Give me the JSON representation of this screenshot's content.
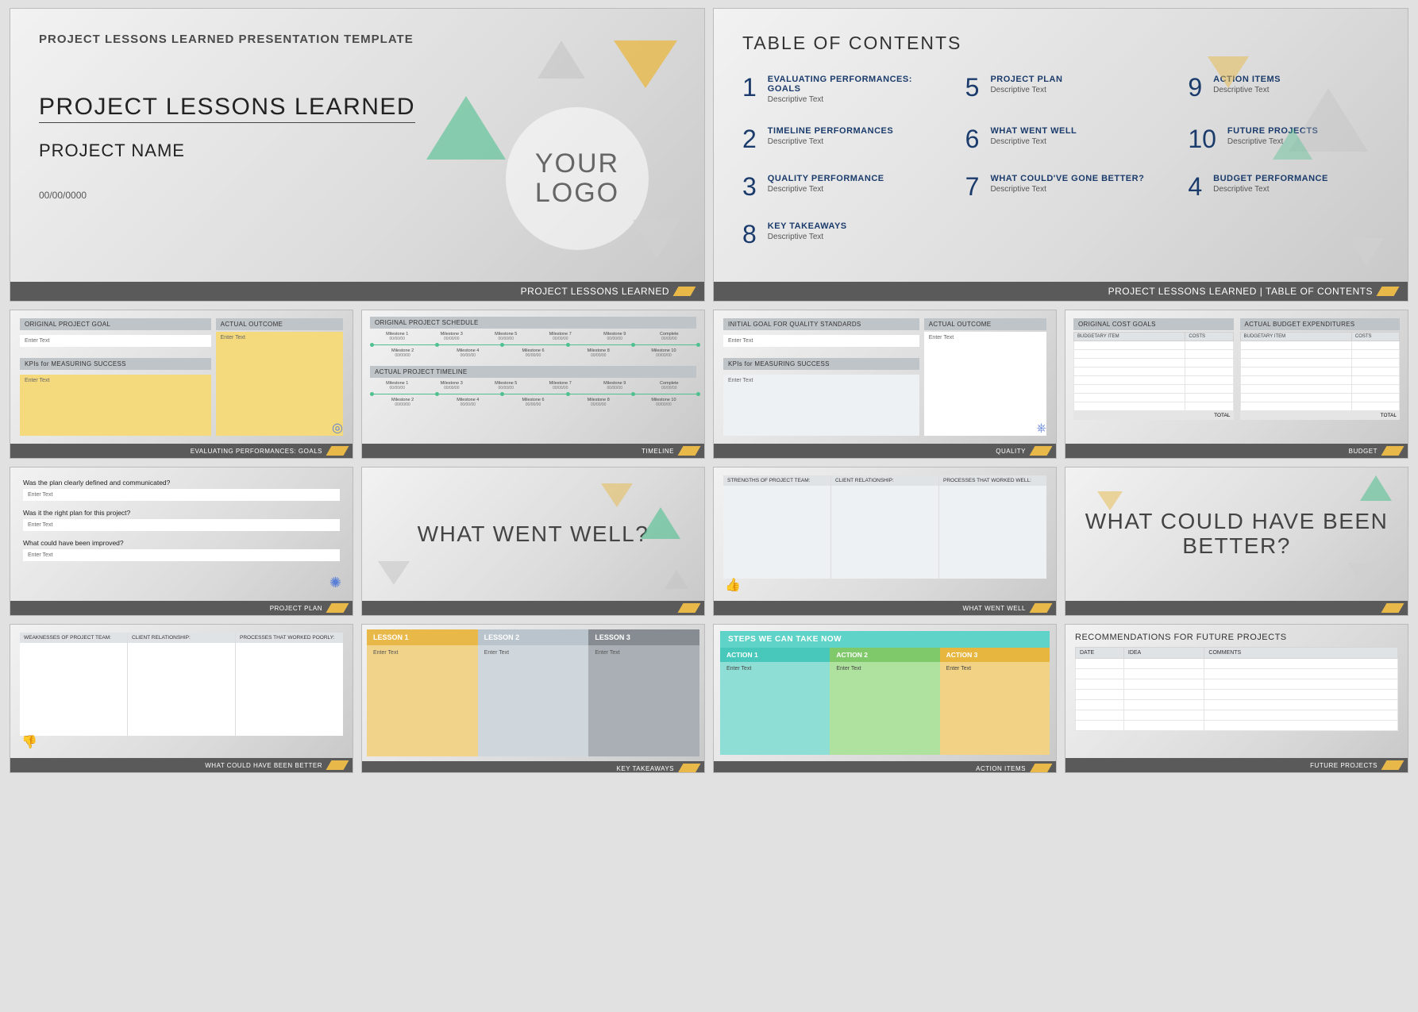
{
  "slide1": {
    "eyebrow": "PROJECT LESSONS LEARNED PRESENTATION TEMPLATE",
    "title": "PROJECT LESSONS LEARNED",
    "sub": "PROJECT NAME",
    "date": "00/00/0000",
    "logo": "YOUR LOGO",
    "footer": "PROJECT LESSONS LEARNED"
  },
  "slide2": {
    "title": "TABLE OF CONTENTS",
    "items": [
      {
        "n": "1",
        "t": "EVALUATING PERFORMANCES: GOALS",
        "d": "Descriptive Text"
      },
      {
        "n": "5",
        "t": "PROJECT PLAN",
        "d": "Descriptive Text"
      },
      {
        "n": "9",
        "t": "ACTION ITEMS",
        "d": "Descriptive Text"
      },
      {
        "n": "2",
        "t": "TIMELINE PERFORMANCES",
        "d": "Descriptive Text"
      },
      {
        "n": "6",
        "t": "WHAT WENT WELL",
        "d": "Descriptive Text"
      },
      {
        "n": "10",
        "t": "FUTURE PROJECTS",
        "d": "Descriptive Text"
      },
      {
        "n": "3",
        "t": "QUALITY PERFORMANCE",
        "d": "Descriptive Text"
      },
      {
        "n": "7",
        "t": "WHAT COULD'VE GONE BETTER?",
        "d": "Descriptive Text"
      },
      {
        "n": "4",
        "t": "BUDGET PERFORMANCE",
        "d": "Descriptive Text"
      },
      {
        "n": "8",
        "t": "KEY TAKEAWAYS",
        "d": "Descriptive Text"
      }
    ],
    "footer": "PROJECT LESSONS LEARNED   |   TABLE OF CONTENTS"
  },
  "slide3": {
    "goal_hdr": "ORIGINAL PROJECT GOAL",
    "outcome_hdr": "ACTUAL OUTCOME",
    "kpi_hdr": "KPIs for MEASURING SUCCESS",
    "enter": "Enter Text",
    "footer": "EVALUATING PERFORMANCES: GOALS"
  },
  "slide4": {
    "sched_hdr": "ORIGINAL PROJECT SCHEDULE",
    "actual_hdr": "ACTUAL PROJECT TIMELINE",
    "ms_top": [
      "Milestone 1",
      "Milestone 3",
      "Milestone 5",
      "Milestone 7",
      "Milestone 9",
      "Complete"
    ],
    "ms_bot": [
      "Milestone 2",
      "Milestone 4",
      "Milestone 6",
      "Milestone 8",
      "Milestone 10"
    ],
    "dt": "00/00/00",
    "footer": "TIMELINE"
  },
  "slide5": {
    "goal_hdr": "INITIAL GOAL FOR QUALITY STANDARDS",
    "outcome_hdr": "ACTUAL OUTCOME",
    "kpi_hdr": "KPIs for MEASURING SUCCESS",
    "enter": "Enter Text",
    "footer": "QUALITY"
  },
  "slide6": {
    "left_hdr": "ORIGINAL COST GOALS",
    "right_hdr": "ACTUAL BUDGET EXPENDITURES",
    "col1": "BUDGETARY ITEM",
    "col2": "COSTS",
    "total": "TOTAL",
    "footer": "BUDGET"
  },
  "slide7": {
    "q1": "Was the plan clearly defined and communicated?",
    "q2": "Was it the right plan for this project?",
    "q3": "What could have been improved?",
    "enter": "Enter Text",
    "footer": "PROJECT PLAN"
  },
  "slide8": {
    "q": "WHAT WENT WELL?",
    "footer": ""
  },
  "slide9": {
    "c1": "STRENGTHS OF PROJECT TEAM:",
    "c2": "CLIENT RELATIONSHIP:",
    "c3": "PROCESSES THAT WORKED WELL:",
    "footer": "WHAT WENT WELL"
  },
  "slide10": {
    "q": "WHAT COULD HAVE BEEN BETTER?",
    "footer": ""
  },
  "slide11": {
    "c1": "WEAKNESSES OF PROJECT TEAM:",
    "c2": "CLIENT RELATIONSHIP:",
    "c3": "PROCESSES THAT WORKED POORLY:",
    "footer": "WHAT COULD HAVE BEEN BETTER"
  },
  "slide12": {
    "l1": "LESSON 1",
    "l2": "LESSON 2",
    "l3": "LESSON 3",
    "enter": "Enter Text",
    "footer": "KEY TAKEAWAYS"
  },
  "slide13": {
    "banner": "STEPS WE CAN TAKE NOW",
    "a1": "ACTION 1",
    "a2": "ACTION 2",
    "a3": "ACTION 3",
    "enter": "Enter Text",
    "footer": "ACTION ITEMS"
  },
  "slide14": {
    "title": "RECOMMENDATIONS FOR FUTURE PROJECTS",
    "c1": "DATE",
    "c2": "IDEA",
    "c3": "COMMENTS",
    "footer": "FUTURE PROJECTS"
  }
}
